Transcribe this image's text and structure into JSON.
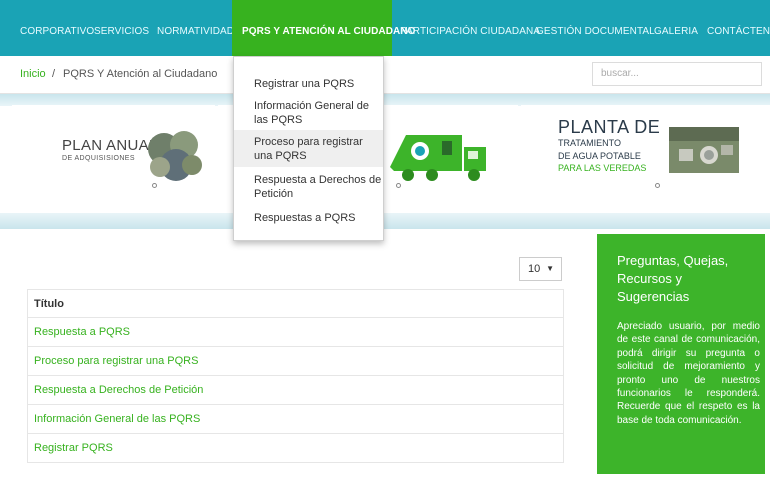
{
  "nav": {
    "items": [
      "CORPORATIVO",
      "SERVICIOS",
      "NORMATIVIDAD",
      "PQRS Y ATENCIÓN AL CIUDADANO",
      "PARTICIPACIÓN CIUDADANA",
      "GESTIÓN DOCUMENTAL",
      "GALERIA",
      "CONTÁCTENOS"
    ],
    "active_index": 3,
    "colors": {
      "bar": "#1aa3b5",
      "active": "#37b21f"
    }
  },
  "breadcrumb": {
    "home": "Inicio",
    "separator": "/",
    "current": "PQRS Y Atención al Ciudadano"
  },
  "search": {
    "placeholder": "buscar..."
  },
  "dropdown": {
    "items": [
      {
        "label": "Registrar una PQRS"
      },
      {
        "label": "Información General de las PQRS"
      },
      {
        "label": "Proceso para registrar una PQRS",
        "highlighted": true
      },
      {
        "label": "Respuesta a Derechos de Petición"
      },
      {
        "label": "Respuestas a PQRS"
      }
    ]
  },
  "banners": {
    "plan": {
      "title": "PLAN ANUAL",
      "subtitle": "DE ADQUISISIONES"
    },
    "planta": {
      "title": "PLANTA DE",
      "line1": "TRATAMIENTO",
      "line2": "DE AGUA POTABLE",
      "line3": "PARA LAS VEREDAS"
    }
  },
  "table": {
    "page_size": "10",
    "header": "Título",
    "rows": [
      "Respuesta a PQRS",
      "Proceso para registrar una PQRS",
      "Respuesta a Derechos de Petición",
      "Información General de las PQRS",
      "Registrar PQRS"
    ]
  },
  "info_box": {
    "title": "Preguntas, Quejas, Recursos y Sugerencias",
    "body": "Apreciado usuario, por medio de este canal de comunicación, podrá dirigir su pregunta o solicitud de mejoramiento y pronto uno de nuestros funcionarios le responderá. Recuerde que el respeto es la base de toda comunicación.",
    "color": "#3db42a"
  }
}
